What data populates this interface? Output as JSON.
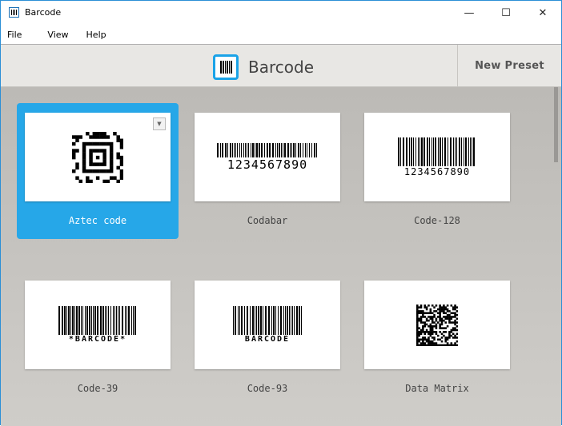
{
  "window": {
    "title": "Barcode",
    "controls": {
      "minimize": "—",
      "maximize": "☐",
      "close": "✕"
    }
  },
  "menu": [
    "File",
    "View",
    "Help"
  ],
  "header": {
    "title": "Barcode",
    "new_preset": "New Preset"
  },
  "presets": [
    {
      "label": "Aztec code",
      "selected": true,
      "type": "aztec"
    },
    {
      "label": "Codabar",
      "type": "linear",
      "text": "1234567890"
    },
    {
      "label": "Code-128",
      "type": "linear",
      "text": "1234567890"
    },
    {
      "label": "Code-39",
      "type": "linear",
      "text": "*BARCODE*"
    },
    {
      "label": "Code-93",
      "type": "linear",
      "text": "BARCODE"
    },
    {
      "label": "Data Matrix",
      "type": "matrix"
    }
  ],
  "colors": {
    "accent": "#26a7e8"
  }
}
